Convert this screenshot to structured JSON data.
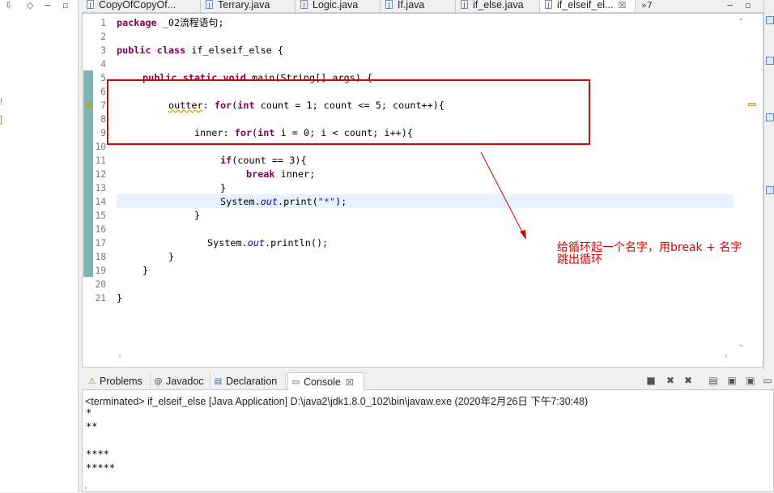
{
  "left": {
    "toolbar_icons": [
      "chevron-down",
      "diamond",
      "minimize",
      "maximize"
    ],
    "markers": [
      "!",
      "]"
    ]
  },
  "editor_tabs": [
    {
      "label": "CopyOfCopyOf...",
      "active": false
    },
    {
      "label": "Terrary.java",
      "active": false
    },
    {
      "label": "Logic.java",
      "active": false
    },
    {
      "label": "If.java",
      "active": false
    },
    {
      "label": "if_else.java",
      "active": false
    },
    {
      "label": "if_elseif_el...",
      "active": true,
      "close": "☒"
    }
  ],
  "tab_overflow": "»7",
  "line_numbers": [
    "1",
    "2",
    "3",
    "4",
    "5",
    "6",
    "7",
    "8",
    "9",
    "10",
    "11",
    "12",
    "13",
    "14",
    "15",
    "16",
    "17",
    "18",
    "19",
    "20",
    "21"
  ],
  "code": {
    "l1_kw": "package",
    "l1_rest": " _02流程语句;",
    "l3_kw1": "public",
    "l3_kw2": "class",
    "l3_rest": " if_elseif_else {",
    "l5_kw1": "public",
    "l5_kw2": "static",
    "l5_kw3": "void",
    "l5_rest": " main(String[] args) {",
    "l7_label": "outter",
    "l7_a": ": ",
    "l7_kw1": "for",
    "l7_b": "(",
    "l7_kw2": "int",
    "l7_c": " count = 1; count <= 5; count++){",
    "l9_label": "inner",
    "l9_a": ": ",
    "l9_kw1": "for",
    "l9_b": "(",
    "l9_kw2": "int",
    "l9_c": " i = 0; i < count; i++){",
    "l11_kw": "if",
    "l11_rest": "(count == 3){",
    "l12_kw": "break",
    "l12_rest": " inner;",
    "l13": "}",
    "l14_a": "System.",
    "l14_fld": "out",
    "l14_b": ".print(",
    "l14_str": "\"*\"",
    "l14_c": ");",
    "l15": "}",
    "l17_a": "System.",
    "l17_fld": "out",
    "l17_b": ".println();",
    "l18": "}",
    "l19": "}",
    "l21": "}"
  },
  "annotation": {
    "line1": "给循环起一个名字，用break + 名字",
    "line2": "跳出循环",
    "color": "#e00000"
  },
  "console": {
    "tabs": [
      {
        "label": "Problems",
        "icon": "problems-icon",
        "active": false
      },
      {
        "label": "Javadoc",
        "icon": "at-icon",
        "active": false
      },
      {
        "label": "Declaration",
        "icon": "declaration-icon",
        "active": false
      },
      {
        "label": "Console",
        "icon": "console-icon",
        "active": true,
        "close": "☒"
      }
    ],
    "status": "<terminated> if_elseif_else [Java Application] D:\\java2\\jdk1.8.0_102\\bin\\javaw.exe (2020年2月26日 下午7:30:48)",
    "output": [
      "*",
      "**",
      "",
      "****",
      "*****"
    ]
  }
}
